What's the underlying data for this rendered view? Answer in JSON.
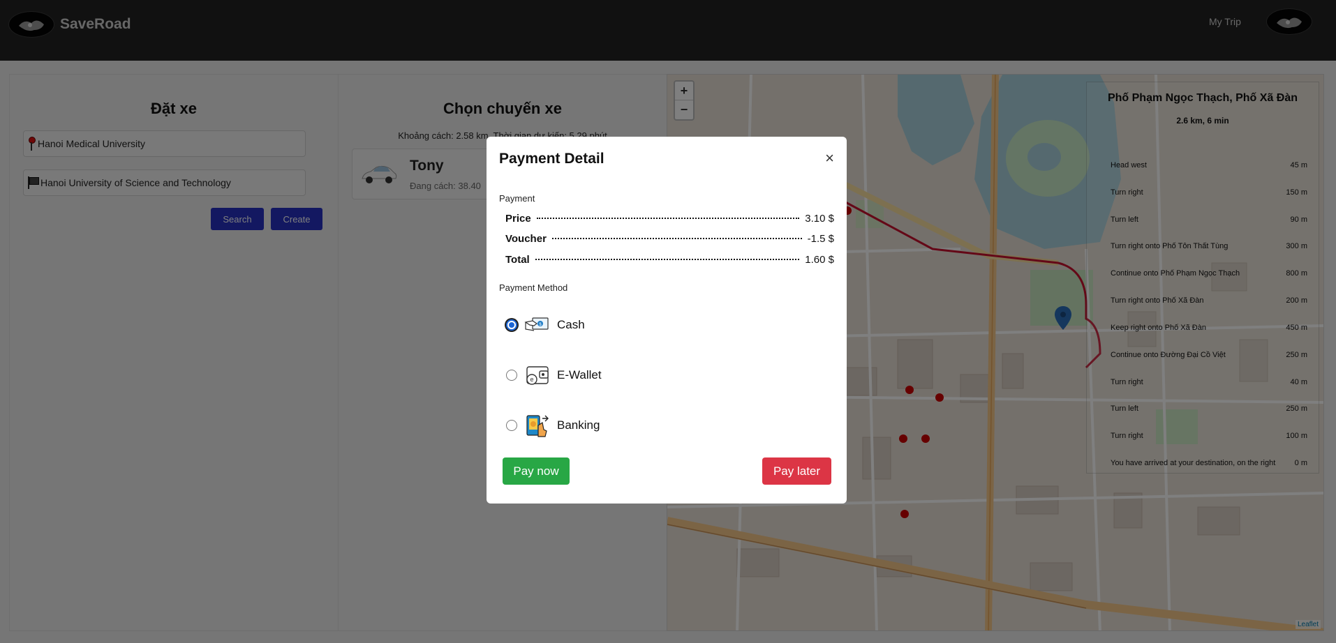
{
  "header": {
    "brand": "SaveRoad",
    "my_trip": "My Trip"
  },
  "booking": {
    "title": "Đặt xe",
    "pickup_value": "Hanoi Medical University",
    "destination_value": "Hanoi University of Science and Technology",
    "search_label": "Search",
    "create_label": "Create"
  },
  "trip": {
    "title": "Chọn chuyến xe",
    "summary": "Khoảng cách: 2.58 km, Thời gian dự kiến: 5.29 phút",
    "driver_name": "Tony",
    "driver_distance": "Đang cách: 38.40"
  },
  "map": {
    "zoom_in": "+",
    "zoom_out": "−",
    "attribution": "Leaflet",
    "route": {
      "title": "Phố Phạm Ngọc Thạch, Phố Xã Đàn",
      "summary": "2.6 km, 6 min",
      "steps": [
        {
          "instruction": "Head west",
          "distance": "45 m"
        },
        {
          "instruction": "Turn right",
          "distance": "150 m"
        },
        {
          "instruction": "Turn left",
          "distance": "90 m"
        },
        {
          "instruction": "Turn right onto Phố Tôn Thất Tùng",
          "distance": "300 m"
        },
        {
          "instruction": "Continue onto Phố Phạm Ngọc Thạch",
          "distance": "800 m"
        },
        {
          "instruction": "Turn right onto Phố Xã Đàn",
          "distance": "200 m"
        },
        {
          "instruction": "Keep right onto Phố Xã Đàn",
          "distance": "450 m"
        },
        {
          "instruction": "Continue onto Đường Đại Cồ Việt",
          "distance": "250 m"
        },
        {
          "instruction": "Turn right",
          "distance": "40 m"
        },
        {
          "instruction": "Turn left",
          "distance": "250 m"
        },
        {
          "instruction": "Turn right",
          "distance": "100 m"
        },
        {
          "instruction": "You have arrived at your destination, on the right",
          "distance": "0 m"
        }
      ]
    }
  },
  "modal": {
    "title": "Payment Detail",
    "close": "×",
    "payment_label": "Payment",
    "price_label": "Price",
    "price_value": "3.10 $",
    "voucher_label": "Voucher",
    "voucher_value": "-1.5 $",
    "total_label": "Total",
    "total_value": "1.60 $",
    "method_label": "Payment Method",
    "methods": [
      {
        "label": "Cash",
        "icon": "cash-icon",
        "selected": true
      },
      {
        "label": "E-Wallet",
        "icon": "e-wallet-icon",
        "selected": false
      },
      {
        "label": "Banking",
        "icon": "banking-icon",
        "selected": false
      }
    ],
    "pay_now": "Pay now",
    "pay_later": "Pay later"
  },
  "colors": {
    "header_bg": "#232323",
    "primary_blue": "#2630c2",
    "pay_now": "#28a745",
    "pay_later": "#dc3545",
    "route_line": "#c8102e"
  }
}
